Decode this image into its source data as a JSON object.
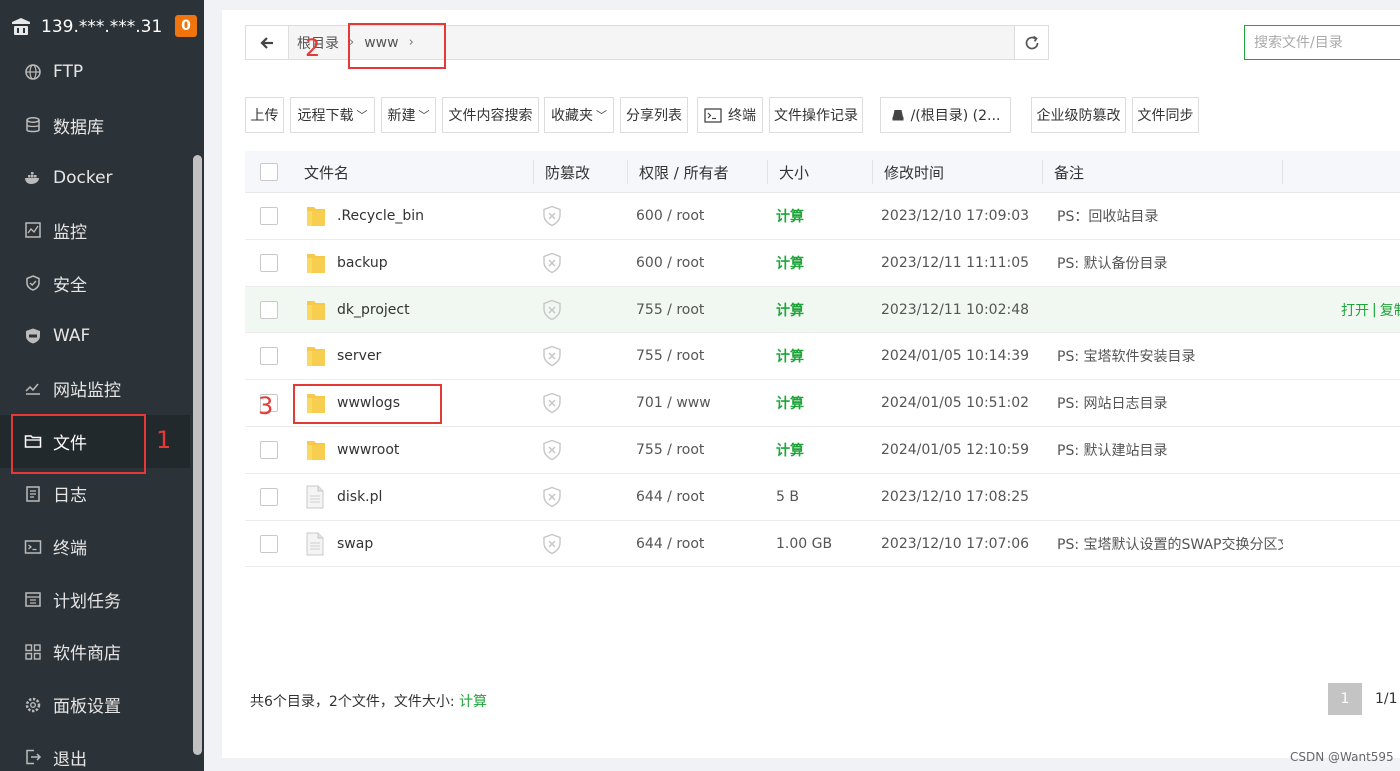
{
  "sidebar": {
    "server_name": "139.***.***.31",
    "badge_count": "0",
    "items": [
      {
        "label": "FTP",
        "icon": "globe-icon"
      },
      {
        "label": "数据库",
        "icon": "database-icon"
      },
      {
        "label": "Docker",
        "icon": "docker-icon"
      },
      {
        "label": "监控",
        "icon": "monitor-icon"
      },
      {
        "label": "安全",
        "icon": "shield-icon"
      },
      {
        "label": "WAF",
        "icon": "waf-icon"
      },
      {
        "label": "网站监控",
        "icon": "chart-icon"
      },
      {
        "label": "文件",
        "icon": "folder-icon"
      },
      {
        "label": "日志",
        "icon": "log-icon"
      },
      {
        "label": "终端",
        "icon": "terminal-icon"
      },
      {
        "label": "计划任务",
        "icon": "calendar-icon"
      },
      {
        "label": "软件商店",
        "icon": "grid-icon"
      },
      {
        "label": "面板设置",
        "icon": "gear-icon"
      },
      {
        "label": "退出",
        "icon": "logout-icon"
      }
    ]
  },
  "path": {
    "root": "根目录",
    "current": "www"
  },
  "search": {
    "placeholder": "搜索文件/目录"
  },
  "toolbar": {
    "upload": "上传",
    "remote_download": "远程下载",
    "new": "新建",
    "content_search": "文件内容搜索",
    "favorites": "收藏夹",
    "share_list": "分享列表",
    "terminal": "终端",
    "op_log": "文件操作记录",
    "disk": "/(根目录) (2...",
    "tamper": "企业级防篡改",
    "sync": "文件同步"
  },
  "table": {
    "headers": {
      "name": "文件名",
      "tamper": "防篡改",
      "perm": "权限 / 所有者",
      "size": "大小",
      "mtime": "修改时间",
      "note": "备注"
    },
    "rows": [
      {
        "name": ".Recycle_bin",
        "type": "folder",
        "perm": "600 / root",
        "size": "计算",
        "mtime": "2023/12/10 17:09:03",
        "note": "PS：回收站目录"
      },
      {
        "name": "backup",
        "type": "folder",
        "perm": "600 / root",
        "size": "计算",
        "mtime": "2023/12/11 11:11:05",
        "note": "PS: 默认备份目录"
      },
      {
        "name": "dk_project",
        "type": "folder",
        "perm": "755 / root",
        "size": "计算",
        "mtime": "2023/12/11 10:02:48",
        "note": ""
      },
      {
        "name": "server",
        "type": "folder",
        "perm": "755 / root",
        "size": "计算",
        "mtime": "2024/01/05 10:14:39",
        "note": "PS: 宝塔软件安装目录"
      },
      {
        "name": "wwwlogs",
        "type": "folder",
        "perm": "701 / www",
        "size": "计算",
        "mtime": "2024/01/05 10:51:02",
        "note": "PS: 网站日志目录"
      },
      {
        "name": "wwwroot",
        "type": "folder",
        "perm": "755 / root",
        "size": "计算",
        "mtime": "2024/01/05 12:10:59",
        "note": "PS: 默认建站目录"
      },
      {
        "name": "disk.pl",
        "type": "file",
        "perm": "644 / root",
        "size": "5 B",
        "mtime": "2023/12/10 17:08:25",
        "note": ""
      },
      {
        "name": "swap",
        "type": "file",
        "perm": "644 / root",
        "size": "1.00 GB",
        "mtime": "2023/12/10 17:07:06",
        "note": "PS: 宝塔默认设置的SWAP交换分区文"
      }
    ],
    "hover_actions": {
      "open": "打开",
      "sep": "|",
      "copy": "复制"
    }
  },
  "footer": {
    "summary": "共6个目录，2个文件，文件大小:",
    "calc": "计算",
    "page_current": "1",
    "page_total": "1/1"
  },
  "annotations": {
    "n1": "1",
    "n2": "2",
    "n3": "3"
  },
  "watermark": "CSDN @Want595",
  "colors": {
    "sidebar_bg": "#2c3338",
    "accent_green": "#20a53a",
    "badge_orange": "#f0750f",
    "annotation_red": "#e53935"
  }
}
